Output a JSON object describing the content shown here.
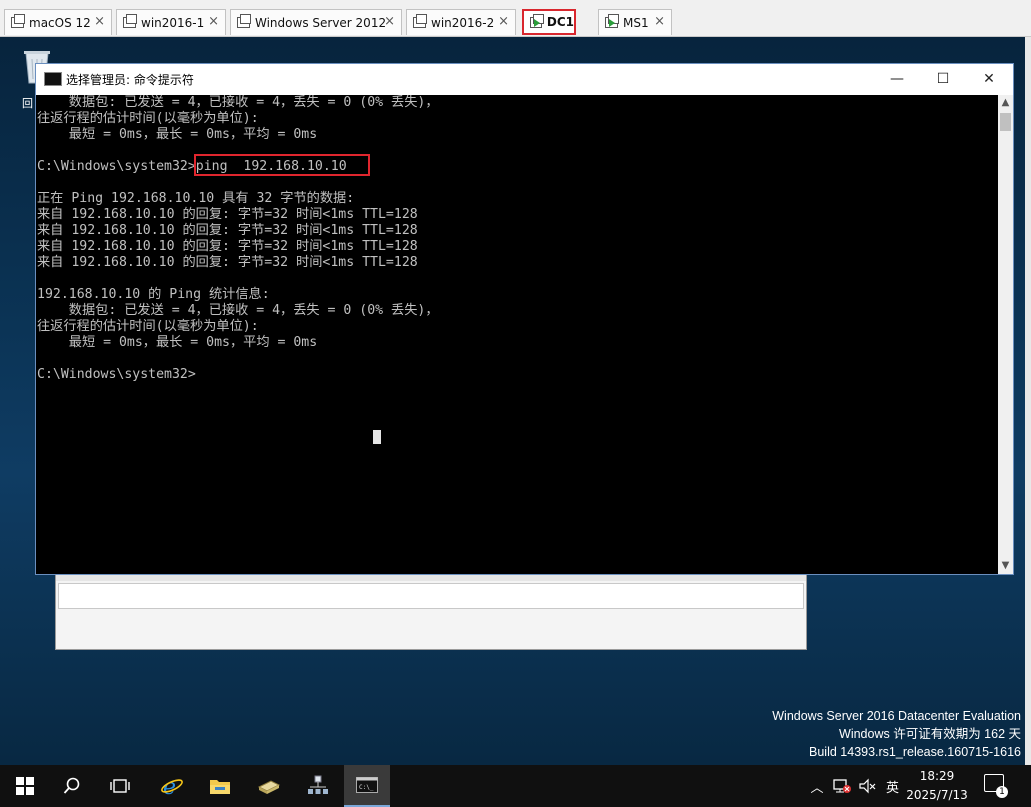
{
  "tabs": [
    {
      "label": "macOS 12",
      "close": "×"
    },
    {
      "label": "win2016-1",
      "close": "×"
    },
    {
      "label": "Windows Server 2012",
      "close": "×"
    },
    {
      "label": "win2016-2",
      "close": "×"
    },
    {
      "label": "DC1",
      "close": "×"
    },
    {
      "label": "MS1",
      "close": "×"
    }
  ],
  "window": {
    "title": "选择管理员: 命令提示符",
    "minimize": "—",
    "maximize": "☐",
    "close": "✕"
  },
  "console_lines": [
    "    数据包: 已发送 = 4，已接收 = 4，丢失 = 0 (0% 丢失)，",
    "往返行程的估计时间(以毫秒为单位):",
    "    最短 = 0ms，最长 = 0ms，平均 = 0ms",
    "",
    "C:\\Windows\\system32>ping  192.168.10.10",
    "",
    "正在 Ping 192.168.10.10 具有 32 字节的数据:",
    "来自 192.168.10.10 的回复: 字节=32 时间<1ms TTL=128",
    "来自 192.168.10.10 的回复: 字节=32 时间<1ms TTL=128",
    "来自 192.168.10.10 的回复: 字节=32 时间<1ms TTL=128",
    "来自 192.168.10.10 的回复: 字节=32 时间<1ms TTL=128",
    "",
    "192.168.10.10 的 Ping 统计信息:",
    "    数据包: 已发送 = 4，已接收 = 4，丢失 = 0 (0% 丢失)，",
    "往返行程的估计时间(以毫秒为单位):",
    "    最短 = 0ms，最长 = 0ms，平均 = 0ms",
    "",
    "C:\\Windows\\system32>"
  ],
  "desktop": {
    "recycle_label": "回"
  },
  "watermark": {
    "line1": "Windows Server 2016 Datacenter Evaluation",
    "line2": "Windows 许可证有效期为 162 天",
    "line3": "Build 14393.rs1_release.160715-1616"
  },
  "taskbar": {
    "tray_chevron": "︿",
    "ime": "英",
    "time": "18:29",
    "date": "2025/7/13",
    "notification_count": "1"
  }
}
